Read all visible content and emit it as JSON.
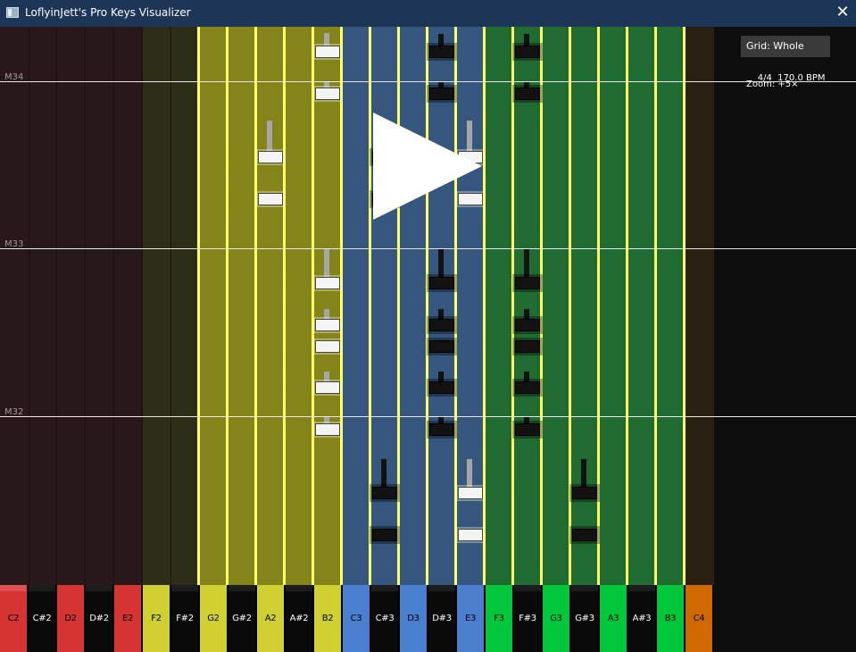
{
  "window": {
    "title": "LoflyinJett's Pro Keys Visualizer",
    "close_glyph": "✕"
  },
  "panel": {
    "grid_label": "Grid: Whole",
    "time_sig": "4/4",
    "bpm": "170.0 BPM",
    "zoom": "Zoom: +5×"
  },
  "measures": [
    "M34",
    "M33",
    "M32"
  ],
  "play_icon": "play-triangle-icon",
  "colors": {
    "lane_red": "#28181a",
    "lane_olive": "#2c2e18",
    "lane_yellow": "#84841a",
    "lane_blue": "#34567f",
    "lane_green": "#1f6b32",
    "lane_orange": "#2a2012",
    "lane_sep": "#ffff66",
    "key_red": "#d63333",
    "key_yellow": "#d0d033",
    "key_blue": "#4a7fd0",
    "key_green": "#00c83a",
    "key_orange": "#d06a00",
    "key_black": "#0a0a0a"
  },
  "keys": [
    {
      "label": "C2",
      "type": "white",
      "color": "red"
    },
    {
      "label": "C#2",
      "type": "black",
      "color": "red"
    },
    {
      "label": "D2",
      "type": "white",
      "color": "red"
    },
    {
      "label": "D#2",
      "type": "black",
      "color": "red"
    },
    {
      "label": "E2",
      "type": "white",
      "color": "red"
    },
    {
      "label": "F2",
      "type": "white",
      "color": "yellow"
    },
    {
      "label": "F#2",
      "type": "black",
      "color": "yellow"
    },
    {
      "label": "G2",
      "type": "white",
      "color": "yellow"
    },
    {
      "label": "G#2",
      "type": "black",
      "color": "yellow"
    },
    {
      "label": "A2",
      "type": "white",
      "color": "yellow"
    },
    {
      "label": "A#2",
      "type": "black",
      "color": "yellow"
    },
    {
      "label": "B2",
      "type": "white",
      "color": "yellow"
    },
    {
      "label": "C3",
      "type": "white",
      "color": "blue"
    },
    {
      "label": "C#3",
      "type": "black",
      "color": "blue"
    },
    {
      "label": "D3",
      "type": "white",
      "color": "blue"
    },
    {
      "label": "D#3",
      "type": "black",
      "color": "blue"
    },
    {
      "label": "E3",
      "type": "white",
      "color": "blue"
    },
    {
      "label": "F3",
      "type": "white",
      "color": "green"
    },
    {
      "label": "F#3",
      "type": "black",
      "color": "green"
    },
    {
      "label": "G3",
      "type": "white",
      "color": "green"
    },
    {
      "label": "G#3",
      "type": "black",
      "color": "green"
    },
    {
      "label": "A3",
      "type": "white",
      "color": "green"
    },
    {
      "label": "A#3",
      "type": "black",
      "color": "green"
    },
    {
      "label": "B3",
      "type": "white",
      "color": "green"
    },
    {
      "label": "C4",
      "type": "white",
      "color": "orange"
    }
  ]
}
